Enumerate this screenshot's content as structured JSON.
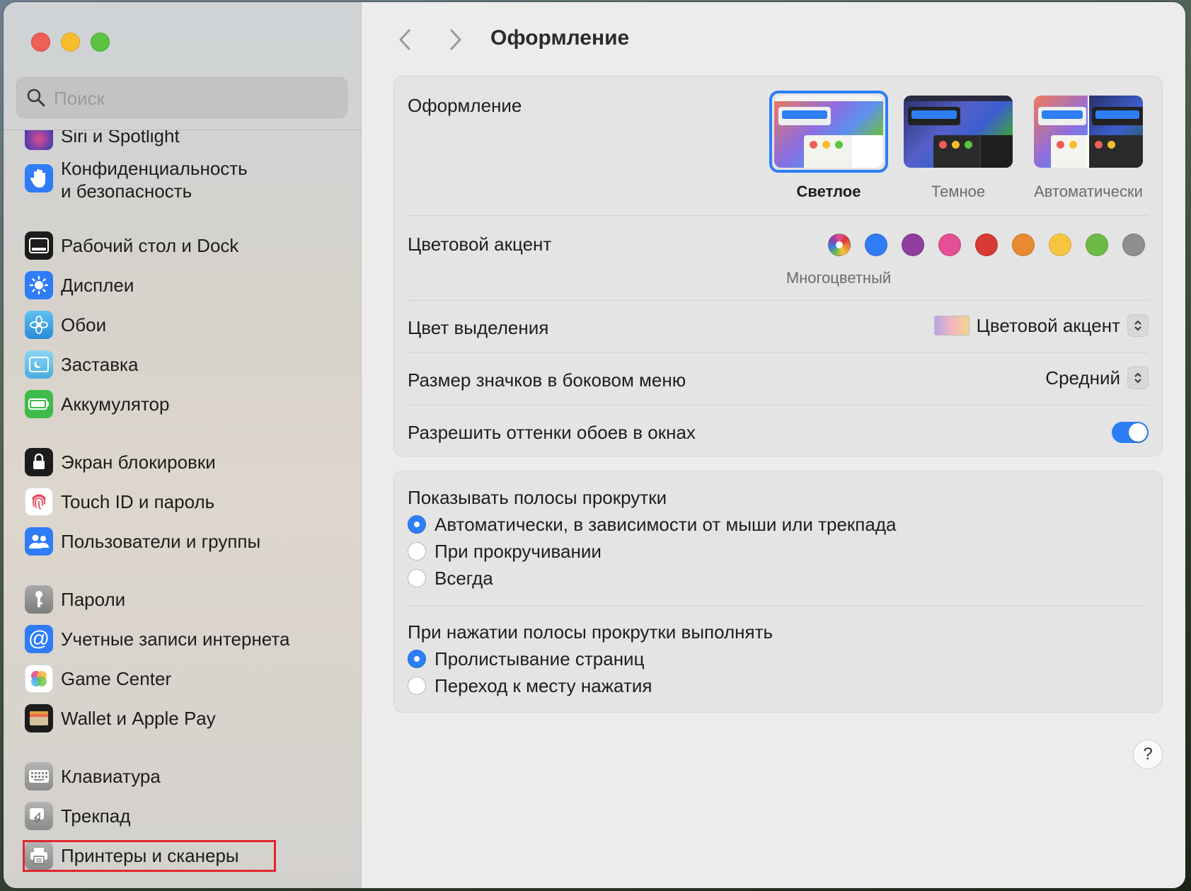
{
  "window": {
    "title": "Оформление"
  },
  "sidebar": {
    "search_placeholder": "Поиск",
    "items": [
      {
        "label": "Siri и Spotlight",
        "icon": "siri-icon",
        "color": "#5b3fb0"
      },
      {
        "label": "Конфиденциальность\nи безопасность",
        "icon": "hand-icon",
        "color": "#2f7cf6"
      },
      {
        "label": "Рабочий стол и Dock",
        "icon": "dock-icon",
        "color": "#1c1c1c"
      },
      {
        "label": "Дисплеи",
        "icon": "sun-icon",
        "color": "#2f7cf6"
      },
      {
        "label": "Обои",
        "icon": "flower-icon",
        "color": "#3aa3e8"
      },
      {
        "label": "Заставка",
        "icon": "screensaver-icon",
        "color": "#54b6e6"
      },
      {
        "label": "Аккумулятор",
        "icon": "battery-icon",
        "color": "#3ebc4a"
      },
      {
        "label": "Экран блокировки",
        "icon": "lock-icon",
        "color": "#1c1c1c"
      },
      {
        "label": "Touch ID и пароль",
        "icon": "fingerprint-icon",
        "color": "#ffffff"
      },
      {
        "label": "Пользователи и группы",
        "icon": "users-icon",
        "color": "#2f7cf6"
      },
      {
        "label": "Пароли",
        "icon": "key-icon",
        "color": "#8e8e8e"
      },
      {
        "label": "Учетные записи интернета",
        "icon": "at-icon",
        "color": "#2f7cf6"
      },
      {
        "label": "Game Center",
        "icon": "game-center-icon",
        "color": "#ffffff"
      },
      {
        "label": "Wallet и Apple Pay",
        "icon": "wallet-icon",
        "color": "#1c1c1c"
      },
      {
        "label": "Клавиатура",
        "icon": "keyboard-icon",
        "color": "#8e8e8e"
      },
      {
        "label": "Трекпад",
        "icon": "trackpad-icon",
        "color": "#8e8e8e"
      },
      {
        "label": "Принтеры и сканеры",
        "icon": "printer-icon",
        "color": "#8e8e8e"
      }
    ]
  },
  "main": {
    "title": "Оформление",
    "appearance": {
      "label": "Оформление",
      "options": [
        {
          "label": "Светлое",
          "selected": true
        },
        {
          "label": "Темное",
          "selected": false
        },
        {
          "label": "Автоматически",
          "selected": false
        }
      ]
    },
    "accent": {
      "label": "Цветовой акцент",
      "selected_name": "Многоцветный",
      "colors": [
        "multicolor",
        "#2f7cf6",
        "#8e3fa0",
        "#e44f96",
        "#d83a35",
        "#e98a32",
        "#f6c540",
        "#6dba46",
        "#8e8e8e"
      ]
    },
    "highlight": {
      "label": "Цвет выделения",
      "value": "Цветовой акцент"
    },
    "sidebar_icon_size": {
      "label": "Размер значков в боковом меню",
      "value": "Средний"
    },
    "wallpaper_tinting": {
      "label": "Разрешить оттенки обоев в окнах",
      "enabled": true
    },
    "scrollbars": {
      "label": "Показывать полосы прокрутки",
      "options": [
        {
          "label": "Автоматически, в зависимости от мыши или трекпада",
          "selected": true
        },
        {
          "label": "При прокручивании",
          "selected": false
        },
        {
          "label": "Всегда",
          "selected": false
        }
      ]
    },
    "click_scrollbar": {
      "label": "При нажатии полосы прокрутки выполнять",
      "options": [
        {
          "label": "Пролистывание страниц",
          "selected": true
        },
        {
          "label": "Переход к месту нажатия",
          "selected": false
        }
      ]
    },
    "help_label": "?"
  },
  "colors": {
    "accent_blue": "#2d7df6",
    "highlight_box": "#e0262b"
  }
}
